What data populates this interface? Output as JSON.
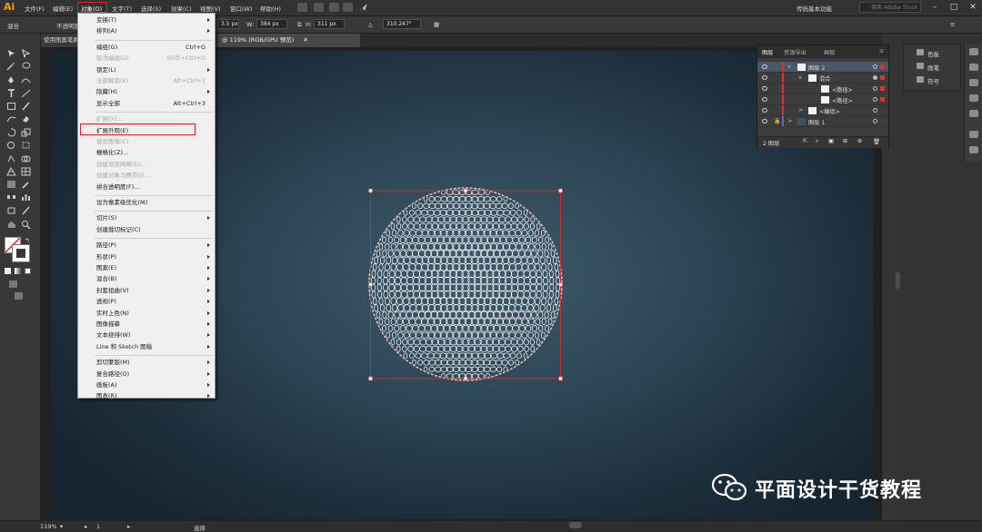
{
  "app": {
    "logo": "Ai",
    "menu": [
      "文件(F)",
      "编辑(E)",
      "对象(O)",
      "文字(T)",
      "选择(S)",
      "效果(C)",
      "视图(V)",
      "窗口(W)",
      "帮助(H)"
    ],
    "workspace": "传统基本功能",
    "stock_placeholder": "搜索 Adobe Stock"
  },
  "controlbar": {
    "label_mixed": "混合",
    "opacity_label": "不透明度",
    "x": "3.5 px",
    "w": "384 px",
    "h": "311 px",
    "angle": "310.247°"
  },
  "tabs": [
    {
      "label": "使用图案笔刷..."
    },
    {
      "label": "@ 119% (RGB/GPU 预览)"
    }
  ],
  "object_menu": {
    "items": [
      {
        "label": "变换(T)",
        "shortcut": "",
        "submenu": true,
        "disabled": false
      },
      {
        "label": "排列(A)",
        "shortcut": "",
        "submenu": true,
        "disabled": false
      },
      {
        "sep": true
      },
      {
        "label": "编组(G)",
        "shortcut": "Ctrl+G",
        "submenu": false,
        "disabled": false
      },
      {
        "label": "取消编组(U)",
        "shortcut": "Shift+Ctrl+G",
        "submenu": false,
        "disabled": true
      },
      {
        "label": "锁定(L)",
        "shortcut": "",
        "submenu": true,
        "disabled": false
      },
      {
        "label": "全部解锁(K)",
        "shortcut": "Alt+Ctrl+2",
        "submenu": false,
        "disabled": true
      },
      {
        "label": "隐藏(H)",
        "shortcut": "",
        "submenu": true,
        "disabled": false
      },
      {
        "label": "显示全部",
        "shortcut": "Alt+Ctrl+3",
        "submenu": false,
        "disabled": false
      },
      {
        "sep": true
      },
      {
        "label": "扩展(X)...",
        "shortcut": "",
        "submenu": false,
        "disabled": true
      },
      {
        "label": "扩展外观(E)",
        "shortcut": "",
        "submenu": false,
        "disabled": false,
        "highlight": true
      },
      {
        "label": "裁剪图像(C)",
        "shortcut": "",
        "submenu": false,
        "disabled": true
      },
      {
        "label": "栅格化(Z)...",
        "shortcut": "",
        "submenu": false,
        "disabled": false
      },
      {
        "label": "创建渐变网格(D)...",
        "shortcut": "",
        "submenu": false,
        "disabled": true
      },
      {
        "label": "创建对象马赛克(J)...",
        "shortcut": "",
        "submenu": false,
        "disabled": true
      },
      {
        "label": "拼合透明度(F)...",
        "shortcut": "",
        "submenu": false,
        "disabled": false
      },
      {
        "sep": true
      },
      {
        "label": "设为像素级优化(M)",
        "shortcut": "",
        "submenu": false,
        "disabled": false
      },
      {
        "sep": true
      },
      {
        "label": "切片(S)",
        "shortcut": "",
        "submenu": true,
        "disabled": false
      },
      {
        "label": "创建裁切标记(C)",
        "shortcut": "",
        "submenu": false,
        "disabled": false
      },
      {
        "sep": true
      },
      {
        "label": "路径(P)",
        "shortcut": "",
        "submenu": true,
        "disabled": false
      },
      {
        "label": "形状(P)",
        "shortcut": "",
        "submenu": true,
        "disabled": false
      },
      {
        "label": "图案(E)",
        "shortcut": "",
        "submenu": true,
        "disabled": false
      },
      {
        "label": "混合(B)",
        "shortcut": "",
        "submenu": true,
        "disabled": false
      },
      {
        "label": "封套扭曲(V)",
        "shortcut": "",
        "submenu": true,
        "disabled": false
      },
      {
        "label": "透视(P)",
        "shortcut": "",
        "submenu": true,
        "disabled": false
      },
      {
        "label": "实时上色(N)",
        "shortcut": "",
        "submenu": true,
        "disabled": false
      },
      {
        "label": "图像描摹",
        "shortcut": "",
        "submenu": true,
        "disabled": false
      },
      {
        "label": "文本绕排(W)",
        "shortcut": "",
        "submenu": true,
        "disabled": false
      },
      {
        "label": "Line 和 Sketch 图稿",
        "shortcut": "",
        "submenu": true,
        "disabled": false
      },
      {
        "sep": true
      },
      {
        "label": "剪切蒙版(M)",
        "shortcut": "",
        "submenu": true,
        "disabled": false
      },
      {
        "label": "复合路径(O)",
        "shortcut": "",
        "submenu": true,
        "disabled": false
      },
      {
        "label": "画板(A)",
        "shortcut": "",
        "submenu": true,
        "disabled": false
      },
      {
        "label": "图表(R)",
        "shortcut": "",
        "submenu": true,
        "disabled": false
      }
    ]
  },
  "layers_panel": {
    "tabs": [
      "图层",
      "资源导出",
      "画板"
    ],
    "rows": [
      {
        "name": "图层 2",
        "indent": 0,
        "selected": true,
        "chevron": "v"
      },
      {
        "name": "混合",
        "indent": 1,
        "selected": false,
        "chevron": "v"
      },
      {
        "name": "<路径>",
        "indent": 2,
        "selected": false,
        "chevron": ""
      },
      {
        "name": "<路径>",
        "indent": 2,
        "selected": false,
        "chevron": ""
      },
      {
        "name": "<编组>",
        "indent": 1,
        "selected": false,
        "chevron": ">"
      },
      {
        "name": "图层 1",
        "indent": 0,
        "selected": false,
        "chevron": ">"
      }
    ],
    "footer": "2 图层"
  },
  "right_panel": {
    "items": [
      {
        "label": "色板",
        "icon": "swatches-icon"
      },
      {
        "label": "画笔",
        "icon": "brushes-icon"
      },
      {
        "label": "符号",
        "icon": "symbols-icon"
      }
    ]
  },
  "statusbar": {
    "zoom": "119%",
    "artboard": "1",
    "mode": "选择"
  },
  "watermark": {
    "text": "平面设计干货教程",
    "icon": "wechat-icon"
  },
  "colors": {
    "highlight_red": "#e0242a",
    "selection_bounds": "#e0302e",
    "art_stroke": "#ffffff"
  }
}
